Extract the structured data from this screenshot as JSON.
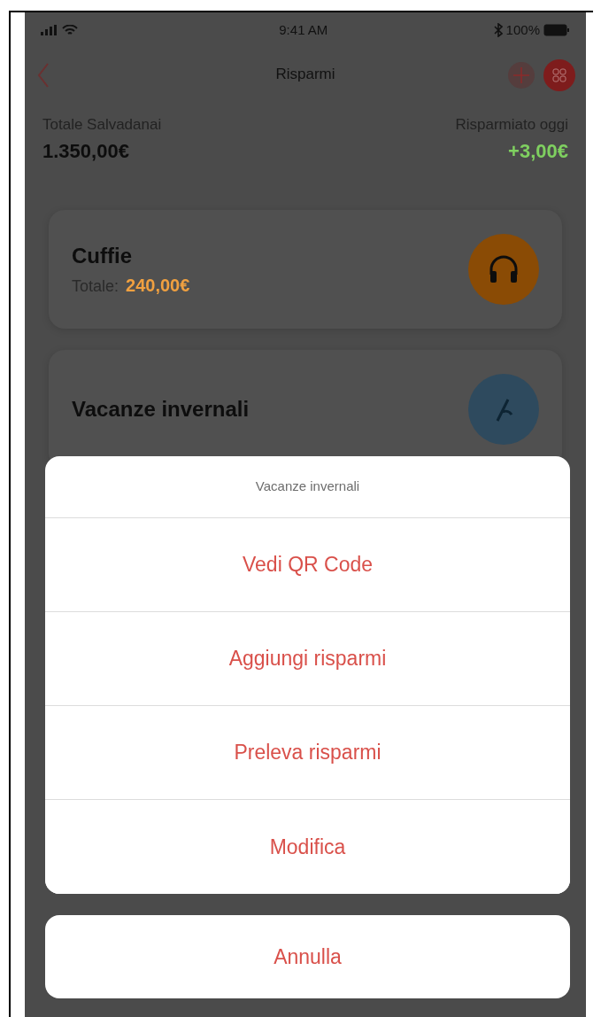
{
  "status_bar": {
    "time": "9:41 AM",
    "battery": "100%"
  },
  "nav": {
    "title": "Risparmi"
  },
  "summary": {
    "total_label": "Totale Salvadanai",
    "total": "1.350,00€",
    "today_label": "Risparmiato oggi",
    "today": "+3,00€"
  },
  "piggy_banks": [
    {
      "name": "Cuffie",
      "total_label": "Totale:",
      "total": "240,00€",
      "color": "#8a4b05",
      "kind": "headphones"
    },
    {
      "name": "Vacanze invernali",
      "color": "#2e4a5e",
      "kind": "holiday"
    }
  ],
  "action_sheet": {
    "title": "Vacanze invernali",
    "actions": [
      "Vedi QR Code",
      "Aggiungi risparmi",
      "Preleva risparmi",
      "Modifica"
    ],
    "cancel": "Annulla"
  }
}
